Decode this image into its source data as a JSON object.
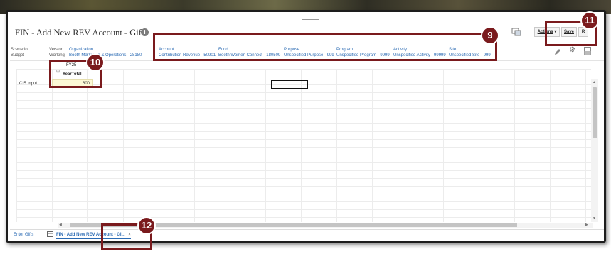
{
  "page": {
    "title": "FIN - Add New REV Account - Gifts",
    "info_icon": "info-icon"
  },
  "toolbar": {
    "actions_label": "Actions",
    "save_label": "Save",
    "more_label": "R",
    "ellipsis": "···"
  },
  "pov": [
    {
      "label": "Scenario",
      "value": "Budget",
      "link": false
    },
    {
      "label": "Version",
      "value": "Working",
      "link": false
    },
    {
      "label": "Organization",
      "value": "Booth Marketing & Operations - 28180",
      "link": true
    },
    {
      "label": "Account",
      "value": "Contribution Revenue - 50901",
      "link": true
    },
    {
      "label": "Fund",
      "value": "Booth Women Connect - 180509",
      "link": true
    },
    {
      "label": "Purpose",
      "value": "Unspecified Purpose - 999",
      "link": true
    },
    {
      "label": "Program",
      "value": "Unspecified Program - 9999",
      "link": true
    },
    {
      "label": "Activity",
      "value": "Unspecified Activity - 99999",
      "link": true
    },
    {
      "label": "Site",
      "value": "Unspecified Site - 999",
      "link": true
    }
  ],
  "grid": {
    "col_header_year": "FY25",
    "col_header_total": "YearTotal",
    "expand_symbol": "⊞",
    "row_label": "CIS Input",
    "cell_value": "600"
  },
  "tabs": [
    {
      "label": "Enter Gifts"
    },
    {
      "label": "FIN - Add New REV Account - Gi...",
      "close": "×"
    }
  ],
  "callouts": [
    "9",
    "10",
    "11",
    "12"
  ],
  "colors": {
    "callout": "#7a1a1d",
    "link": "#2a6ab3",
    "cell_highlight": "#fdf8d6"
  }
}
